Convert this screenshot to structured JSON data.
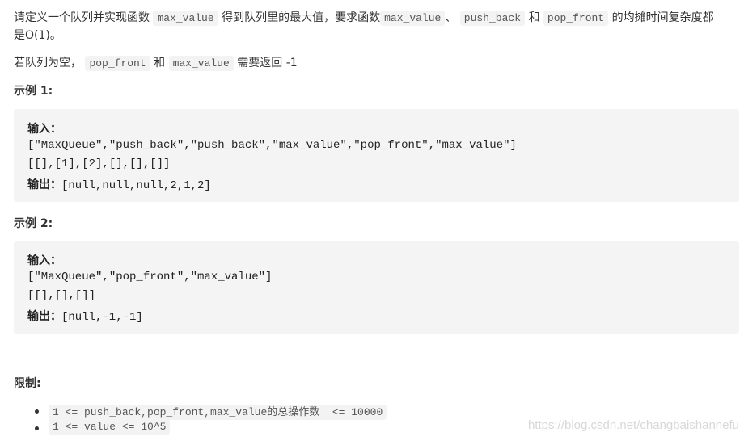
{
  "intro": {
    "p1a": "请定义一个队列并实现函数",
    "c1": "max_value",
    "p1b": "得到队列里的最大值，要求函数",
    "c2": "max_value",
    "p1c": "、",
    "c3": "push_back",
    "p1d": "和",
    "c4": "pop_front",
    "p1e": "的均摊时间复杂度都",
    "p1f": "是O(1)。",
    "p2a": "若队列为空，",
    "c5": "pop_front",
    "p2b": "和",
    "c6": "max_value",
    "p2c": "需要返回 -1"
  },
  "example1": {
    "title": "示例 1:",
    "input_label": "输入：",
    "line1": "[\"MaxQueue\",\"push_back\",\"push_back\",\"max_value\",\"pop_front\",\"max_value\"]",
    "line2": "[[],[1],[2],[],[],[]]",
    "output_label": "输出：",
    "output": "[null,null,null,2,1,2]"
  },
  "example2": {
    "title": "示例 2:",
    "input_label": "输入：",
    "line1": "[\"MaxQueue\",\"pop_front\",\"max_value\"]",
    "line2": "[[],[],[]]",
    "output_label": "输出：",
    "output": "[null,-1,-1]"
  },
  "limits": {
    "title": "限制:",
    "items": [
      "1 <= push_back,pop_front,max_value的总操作数  <= 10000",
      "1 <= value <= 10^5"
    ]
  },
  "watermark": "https://blog.csdn.net/changbaishannefu"
}
